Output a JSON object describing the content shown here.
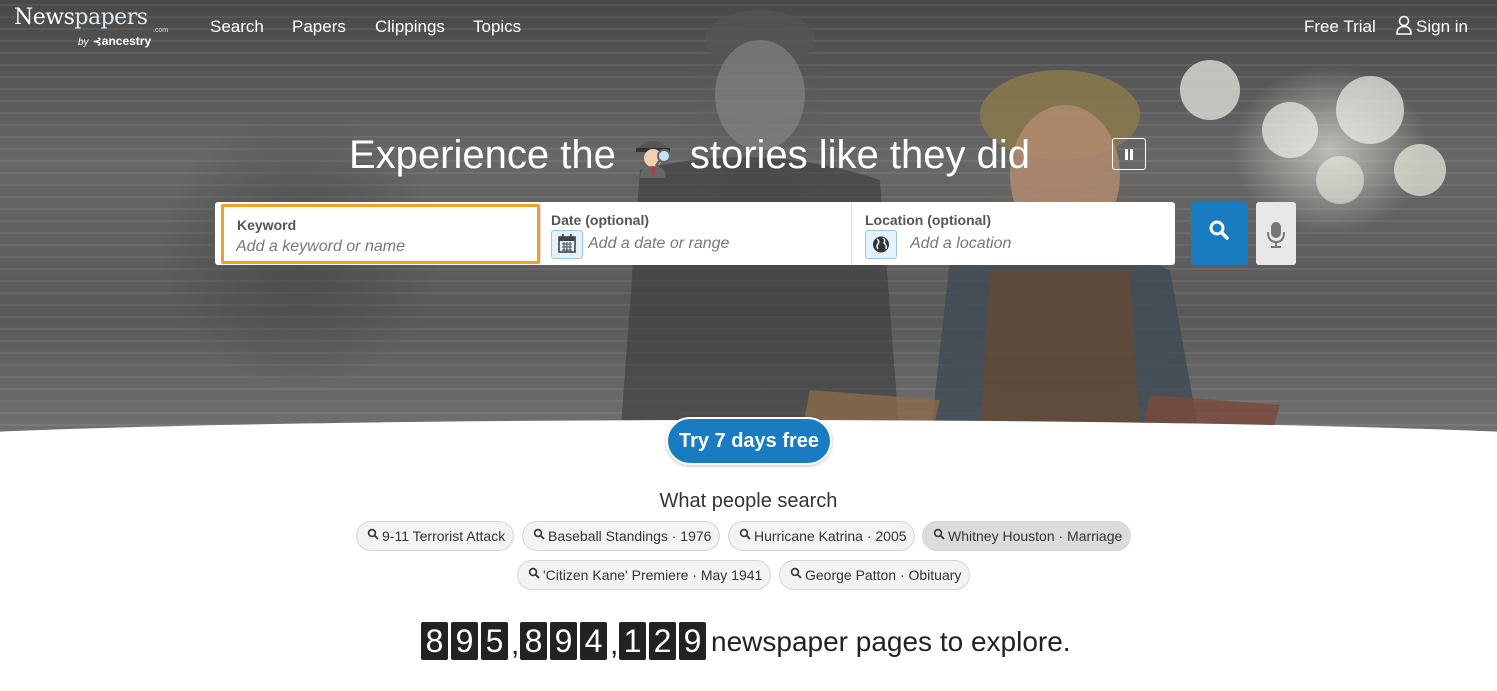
{
  "nav": {
    "logo": {
      "main_a": "News",
      "main_b": "papers",
      "com": ".com",
      "by": "by",
      "ancestry": "ancestry"
    },
    "links": [
      "Search",
      "Papers",
      "Clippings",
      "Topics"
    ],
    "free_trial": "Free Trial",
    "sign_in": "Sign in"
  },
  "hero": {
    "headline_before": "Experience the",
    "headline_after": "stories like they did",
    "headline_icon": "detective-emoji-icon"
  },
  "search": {
    "keyword": {
      "label": "Keyword",
      "placeholder": "Add a keyword or name"
    },
    "date": {
      "label": "Date (optional)",
      "placeholder": "Add a date or range",
      "icon": "calendar-icon"
    },
    "location": {
      "label": "Location (optional)",
      "placeholder": "Add a location",
      "icon": "globe-icon"
    },
    "submit_icon": "search-icon",
    "voice_icon": "microphone-icon"
  },
  "cta": {
    "try_label": "Try 7 days free"
  },
  "popular": {
    "title": "What people search",
    "chips": [
      "9-11 Terrorist Attack",
      "Baseball Standings · 1976",
      "Hurricane Katrina · 2005",
      "Whitney Houston · Marriage",
      "'Citizen Kane' Premiere · May 1941",
      "George Patton · Obituary"
    ]
  },
  "counter": {
    "digits": [
      "8",
      "9",
      "5",
      ",",
      "8",
      "9",
      "4",
      ",",
      "1",
      "2",
      "9"
    ],
    "text": "newspaper pages to explore."
  },
  "colors": {
    "brand_blue": "#1a7cc0",
    "focus_orange": "#f0a030"
  }
}
